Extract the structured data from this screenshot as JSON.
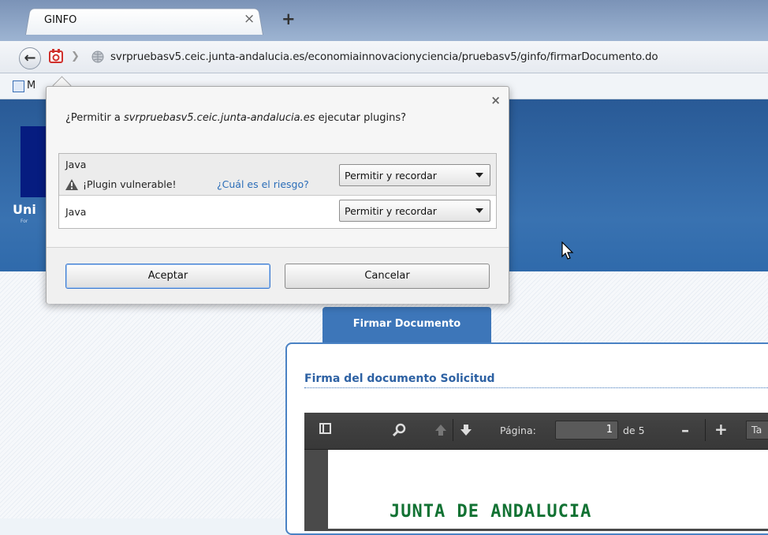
{
  "browser": {
    "tab": {
      "title": "GINFO",
      "close_glyph": "×"
    },
    "new_tab_glyph": "+",
    "url": "svrpruebasv5.ceic.junta-andalucia.es/economiainnovacionyciencia/pruebasv5/ginfo/firmarDocumento.do",
    "bookmark": {
      "label": "M"
    }
  },
  "popup": {
    "question_prefix": "¿Permitir a ",
    "question_host": "svrpruebasv5.ceic.junta-andalucia.es",
    "question_suffix": " ejecutar plugins?",
    "close_glyph": "×",
    "plugins": [
      {
        "name": "Java",
        "warning": "¡Plugin vulnerable!",
        "risk_link": "¿Cuál es el riesgo?",
        "selected": "Permitir y recordar"
      },
      {
        "name": "Java",
        "selected": "Permitir y recordar"
      }
    ],
    "accept_label": "Aceptar",
    "cancel_label": "Cancelar"
  },
  "page": {
    "logo_text": "Uni",
    "logo_sub": "For",
    "tab_label": "Firmar Documento",
    "section_title": "Firma del documento Solicitud",
    "pdf": {
      "page_label": "Página:",
      "page_value": "1",
      "page_count": "de 5",
      "zoom_partial": "Ta",
      "heading": "JUNTA DE ANDALUCIA"
    }
  }
}
